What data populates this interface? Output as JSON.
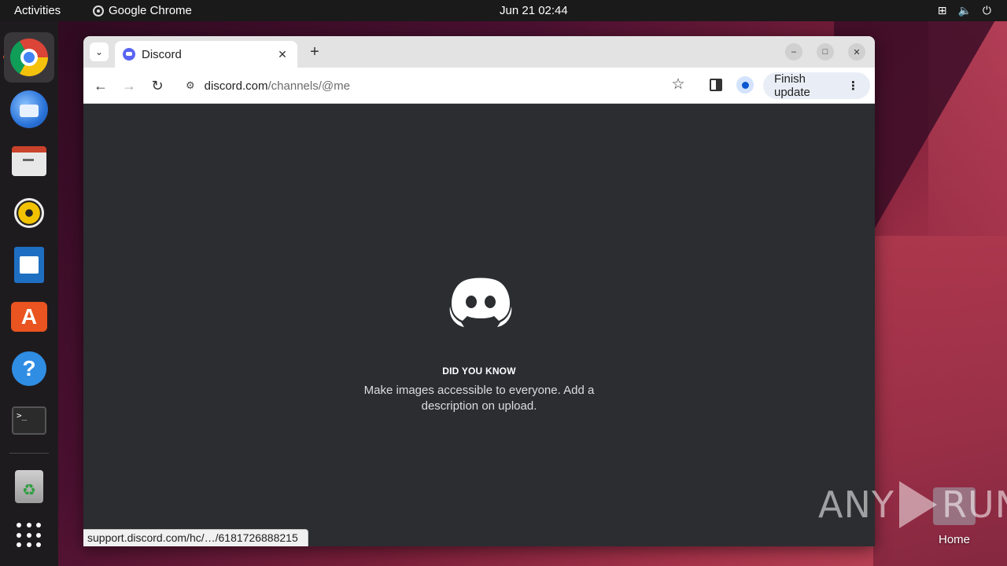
{
  "topbar": {
    "activities": "Activities",
    "app_name": "Google Chrome",
    "clock": "Jun 21  02:44"
  },
  "dock": {
    "items": [
      "chrome-icon",
      "thunderbird-icon",
      "files-icon",
      "rhythmbox-icon",
      "writer-icon",
      "app-center-icon",
      "help-icon",
      "terminal-icon",
      "trash-icon",
      "show-apps-icon"
    ]
  },
  "browser": {
    "tab_title": "Discord",
    "new_tab": "+",
    "url_host": "discord.com",
    "url_path": "/channels/@me",
    "update_label": "Finish update",
    "update_menu": "⋮"
  },
  "page": {
    "dyk_title": "DID YOU KNOW",
    "dyk_text": "Make images accessible to everyone. Add a description on upload.",
    "status_url": "support.discord.com/hc/…/6181726888215"
  },
  "desktop": {
    "watermark_left": "ANY",
    "watermark_right": "RUN",
    "home_label": "Home"
  },
  "colors": {
    "discord_bg": "#2b2d31",
    "blurple": "#5865f2",
    "ubuntu_orange": "#e95420"
  }
}
